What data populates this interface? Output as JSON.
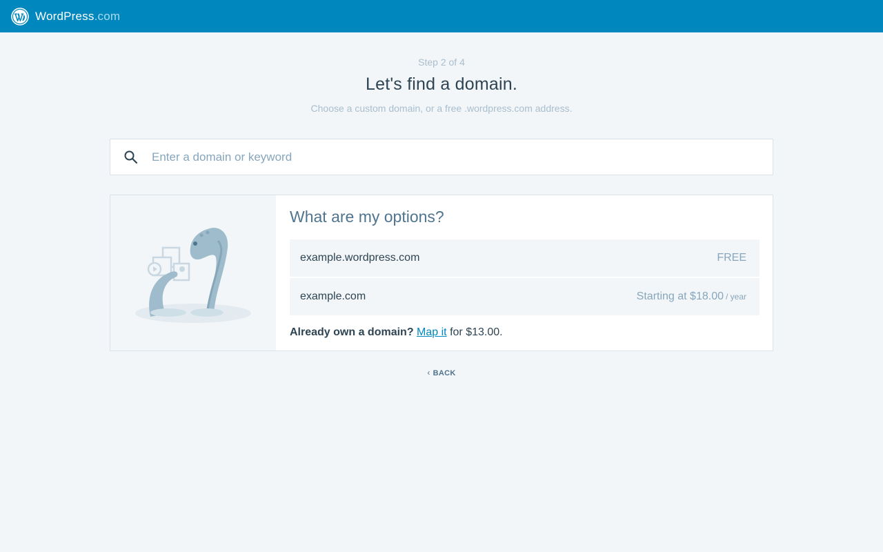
{
  "masterbar": {
    "brand_main": "WordPress",
    "brand_suffix": ".com",
    "logo_icon": "wordpress-logo-icon",
    "color": "#0087be"
  },
  "header": {
    "step": "Step 2 of 4",
    "title": "Let's find a domain.",
    "subtitle": "Choose a custom domain, or a free .wordpress.com address."
  },
  "search": {
    "icon": "search-icon",
    "placeholder": "Enter a domain or keyword",
    "value": ""
  },
  "options": {
    "title": "What are my options?",
    "items": [
      {
        "domain": "example.wordpress.com",
        "price": "FREE",
        "unit": ""
      },
      {
        "domain": "example.com",
        "price": "Starting at $18.00",
        "unit": "/ year"
      }
    ],
    "already_own_label": "Already own a domain?",
    "map_link": "Map it",
    "map_price": "for $13.00."
  },
  "back": {
    "icon": "chevron-left-icon",
    "label": "BACK"
  },
  "colors": {
    "accent": "#0087be",
    "background": "#f3f6f8",
    "text": "#2e4453",
    "muted": "#87a6bc"
  }
}
